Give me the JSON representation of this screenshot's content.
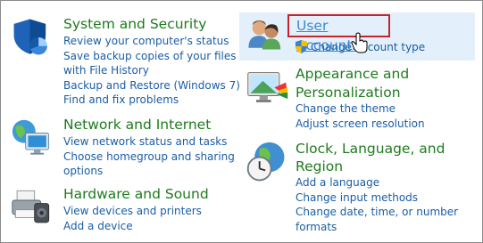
{
  "categories": {
    "system": {
      "title": "System and Security",
      "links": [
        "Review your computer's status",
        "Save backup copies of your files",
        "with File History",
        "Backup and Restore (Windows 7)",
        "Find and fix problems"
      ]
    },
    "network": {
      "title": "Network and Internet",
      "links": [
        "View network status and tasks",
        "Choose homegroup and sharing",
        "options"
      ]
    },
    "hardware": {
      "title": "Hardware and Sound",
      "links": [
        "View devices and printers",
        "Add a device"
      ]
    },
    "user_accounts": {
      "title": "User Accounts",
      "links": [
        "Change account type"
      ]
    },
    "appearance": {
      "title_line1": "Appearance and",
      "title_line2": "Personalization",
      "links": [
        "Change the theme",
        "Adjust screen resolution"
      ]
    },
    "clock": {
      "title_line1": "Clock, Language, and",
      "title_line2": "Region",
      "links": [
        "Add a language",
        "Change input methods",
        "Change date, time, or number",
        "formats"
      ]
    }
  },
  "colors": {
    "category_title": "#1e7b1e",
    "link": "#1a5ea6",
    "hover_title": "#3a8ad6",
    "highlight_bg": "#e3effa",
    "focus_border": "#c0262c"
  }
}
